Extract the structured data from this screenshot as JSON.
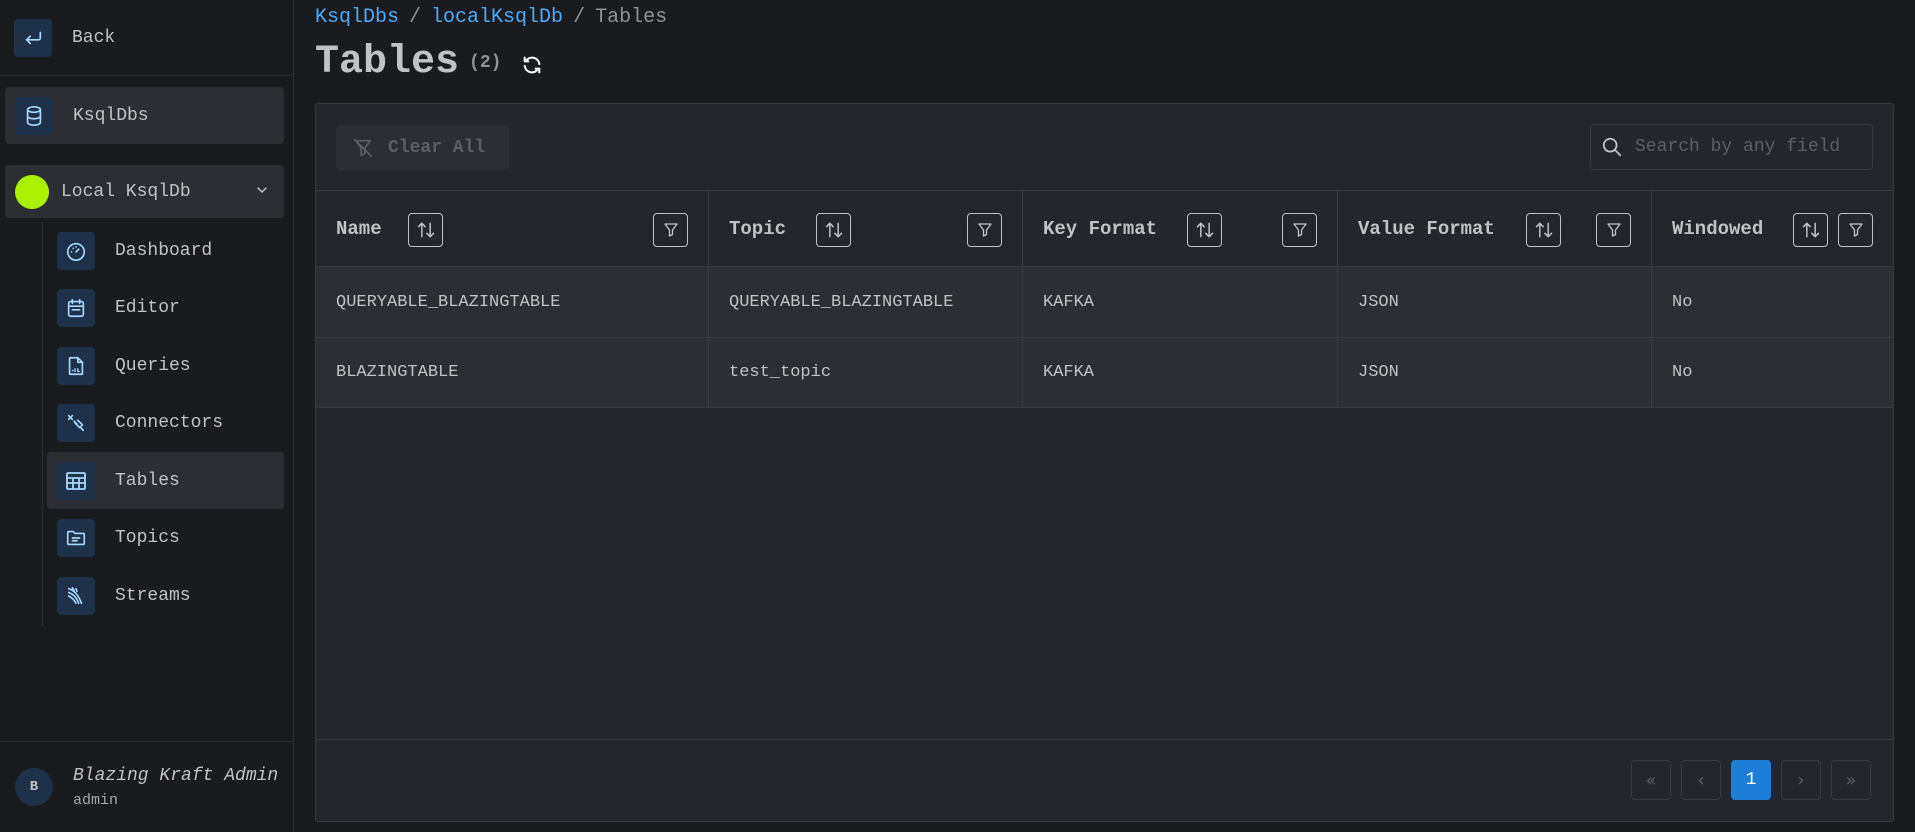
{
  "sidebar": {
    "back_label": "Back",
    "section_label": "KsqlDbs",
    "cluster": {
      "name": "Local KsqlDb",
      "status_color": "#aaf200"
    },
    "items": [
      {
        "label": "Dashboard",
        "icon": "gauge-icon"
      },
      {
        "label": "Editor",
        "icon": "calendar-icon"
      },
      {
        "label": "Queries",
        "icon": "sql-file-icon"
      },
      {
        "label": "Connectors",
        "icon": "plug-connector-icon"
      },
      {
        "label": "Tables",
        "icon": "table-icon",
        "active": true
      },
      {
        "label": "Topics",
        "icon": "folder-icon"
      },
      {
        "label": "Streams",
        "icon": "streams-icon"
      }
    ],
    "user": {
      "avatar_letter": "B",
      "name": "Blazing Kraft Admin",
      "role": "admin"
    }
  },
  "breadcrumb": {
    "items": [
      "KsqlDbs",
      "localKsqlDb"
    ],
    "separator": "/",
    "current": "Tables"
  },
  "page": {
    "title": "Tables",
    "count": "(2)"
  },
  "toolbar": {
    "clear_label": "Clear All",
    "search_placeholder": "Search by any field"
  },
  "table": {
    "columns": [
      "Name",
      "Topic",
      "Key Format",
      "Value Format",
      "Windowed"
    ],
    "rows": [
      [
        "QUERYABLE_BLAZINGTABLE",
        "QUERYABLE_BLAZINGTABLE",
        "KAFKA",
        "JSON",
        "No"
      ],
      [
        "BLAZINGTABLE",
        "test_topic",
        "KAFKA",
        "JSON",
        "No"
      ]
    ]
  },
  "pagination": {
    "current_page": "1",
    "first": "«",
    "prev": "‹",
    "next": "›",
    "last": "»"
  },
  "colors": {
    "accent": "#1c7ed6",
    "link": "#4dabf7",
    "background": "#1a1b1e",
    "panel": "#25262b"
  }
}
